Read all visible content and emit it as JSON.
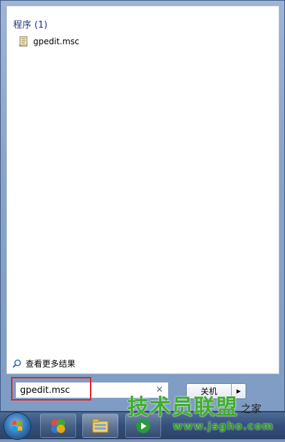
{
  "results": {
    "header": "程序 (1)",
    "items": [
      {
        "label": "gpedit.msc",
        "icon": "script-file-icon"
      }
    ],
    "see_more": "查看更多结果"
  },
  "search": {
    "value": "gpedit.msc",
    "clear_glyph": "×"
  },
  "shutdown": {
    "label": "关机",
    "arrow_glyph": "▶"
  },
  "taskbar": {
    "apps": [
      "start-orb",
      "color-app-icon",
      "explorer-folder-icon",
      "media-player-icon"
    ]
  },
  "watermark": {
    "title": "技术员联盟",
    "site": "www.jsgho.com",
    "side": "之家"
  },
  "colors": {
    "accent_header": "#1e3287",
    "highlight": "#e0242a",
    "watermark_green": "#3fae2a"
  }
}
